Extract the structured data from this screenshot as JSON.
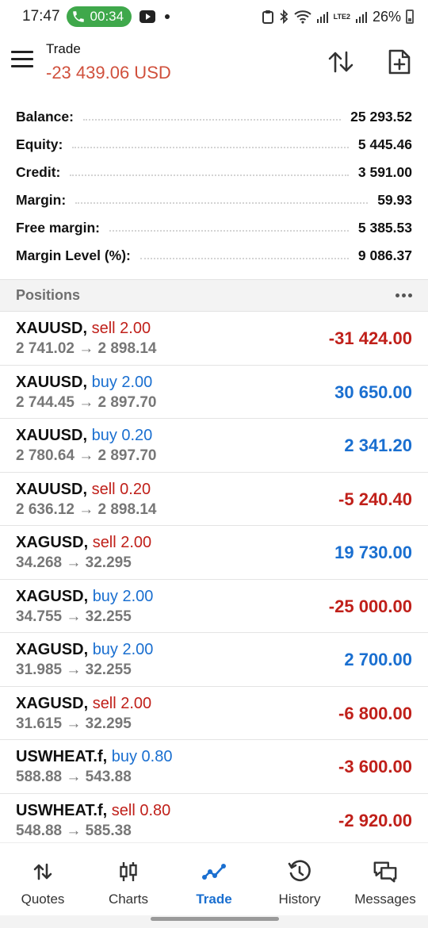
{
  "status_bar": {
    "time": "17:47",
    "call_duration": "00:34",
    "network": "LTE2",
    "battery": "26%"
  },
  "header": {
    "title": "Trade",
    "pnl": "-23 439.06 USD"
  },
  "summary": [
    {
      "label": "Balance:",
      "value": "25 293.52"
    },
    {
      "label": "Equity:",
      "value": "5 445.46"
    },
    {
      "label": "Credit:",
      "value": "3 591.00"
    },
    {
      "label": "Margin:",
      "value": "59.93"
    },
    {
      "label": "Free margin:",
      "value": "5 385.53"
    },
    {
      "label": "Margin Level (%):",
      "value": "9 086.37"
    }
  ],
  "positions": {
    "title": "Positions",
    "items": [
      {
        "symbol": "XAUUSD,",
        "side": "sell 2.00",
        "prices": "2 741.02 → 2 898.14",
        "profit": "-31 424.00",
        "direction": "sell",
        "sign": "neg"
      },
      {
        "symbol": "XAUUSD,",
        "side": "buy 2.00",
        "prices": "2 744.45 → 2 897.70",
        "profit": "30 650.00",
        "direction": "buy",
        "sign": "pos"
      },
      {
        "symbol": "XAUUSD,",
        "side": "buy 0.20",
        "prices": "2 780.64 → 2 897.70",
        "profit": "2 341.20",
        "direction": "buy",
        "sign": "pos"
      },
      {
        "symbol": "XAUUSD,",
        "side": "sell 0.20",
        "prices": "2 636.12 → 2 898.14",
        "profit": "-5 240.40",
        "direction": "sell",
        "sign": "neg"
      },
      {
        "symbol": "XAGUSD,",
        "side": "sell 2.00",
        "prices": "34.268 → 32.295",
        "profit": "19 730.00",
        "direction": "sell",
        "sign": "pos"
      },
      {
        "symbol": "XAGUSD,",
        "side": "buy 2.00",
        "prices": "34.755 → 32.255",
        "profit": "-25 000.00",
        "direction": "buy",
        "sign": "neg"
      },
      {
        "symbol": "XAGUSD,",
        "side": "buy 2.00",
        "prices": "31.985 → 32.255",
        "profit": "2 700.00",
        "direction": "buy",
        "sign": "pos"
      },
      {
        "symbol": "XAGUSD,",
        "side": "sell 2.00",
        "prices": "31.615 → 32.295",
        "profit": "-6 800.00",
        "direction": "sell",
        "sign": "neg"
      },
      {
        "symbol": "USWHEAT.f,",
        "side": "buy 0.80",
        "prices": "588.88 → 543.88",
        "profit": "-3 600.00",
        "direction": "buy",
        "sign": "neg"
      },
      {
        "symbol": "USWHEAT.f,",
        "side": "sell 0.80",
        "prices": "548.88 → 585.38",
        "profit": "-2 920.00",
        "direction": "sell",
        "sign": "neg"
      }
    ]
  },
  "nav": [
    {
      "label": "Quotes",
      "icon": "quotes-icon",
      "active": false
    },
    {
      "label": "Charts",
      "icon": "charts-icon",
      "active": false
    },
    {
      "label": "Trade",
      "icon": "trade-icon",
      "active": true
    },
    {
      "label": "History",
      "icon": "history-icon",
      "active": false
    },
    {
      "label": "Messages",
      "icon": "messages-icon",
      "active": false
    }
  ],
  "colors": {
    "sell": "#c0201a",
    "buy": "#1a6fd0",
    "header_pnl": "#d0503c",
    "call_pill": "#3fa84b"
  }
}
